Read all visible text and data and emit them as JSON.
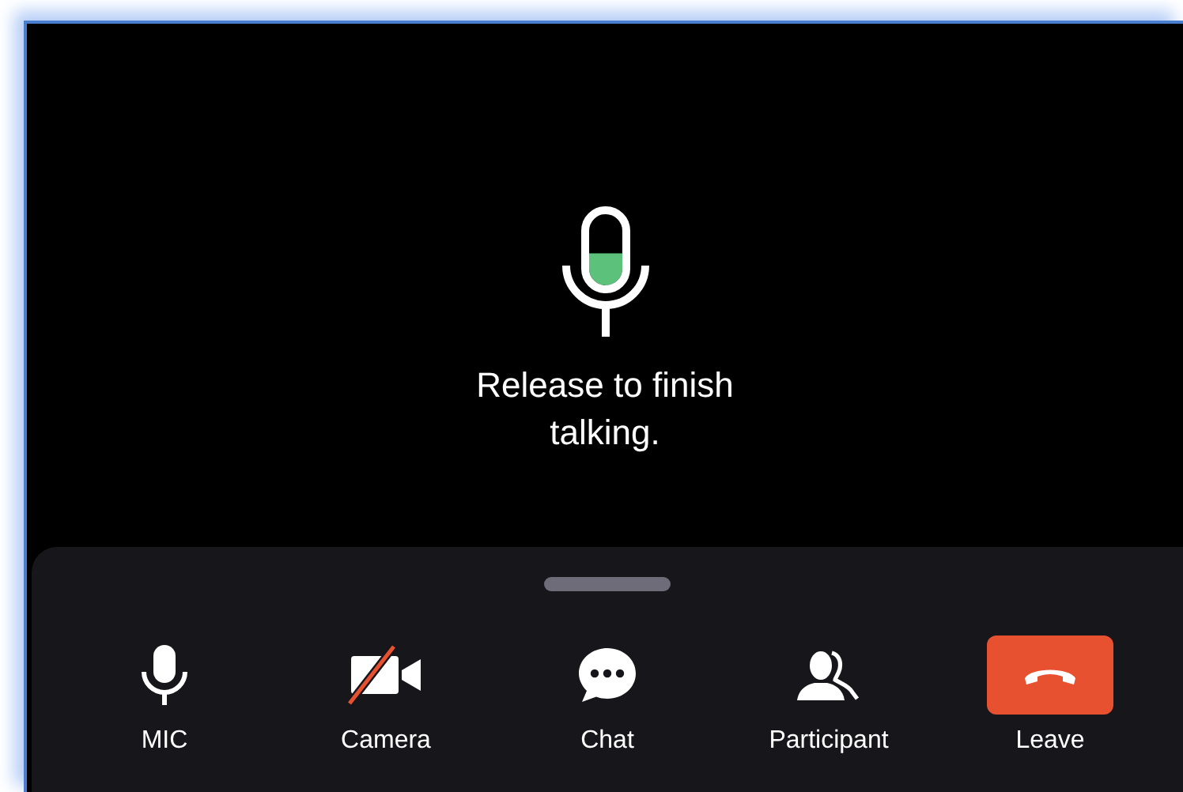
{
  "talk_indicator": {
    "message": "Release to finish talking."
  },
  "controls": [
    {
      "kind": "mic",
      "label": "MIC",
      "off": false
    },
    {
      "kind": "camera",
      "label": "Camera",
      "off": true
    },
    {
      "kind": "chat",
      "label": "Chat"
    },
    {
      "kind": "participants",
      "label": "Participant"
    },
    {
      "kind": "leave",
      "label": "Leave"
    }
  ]
}
